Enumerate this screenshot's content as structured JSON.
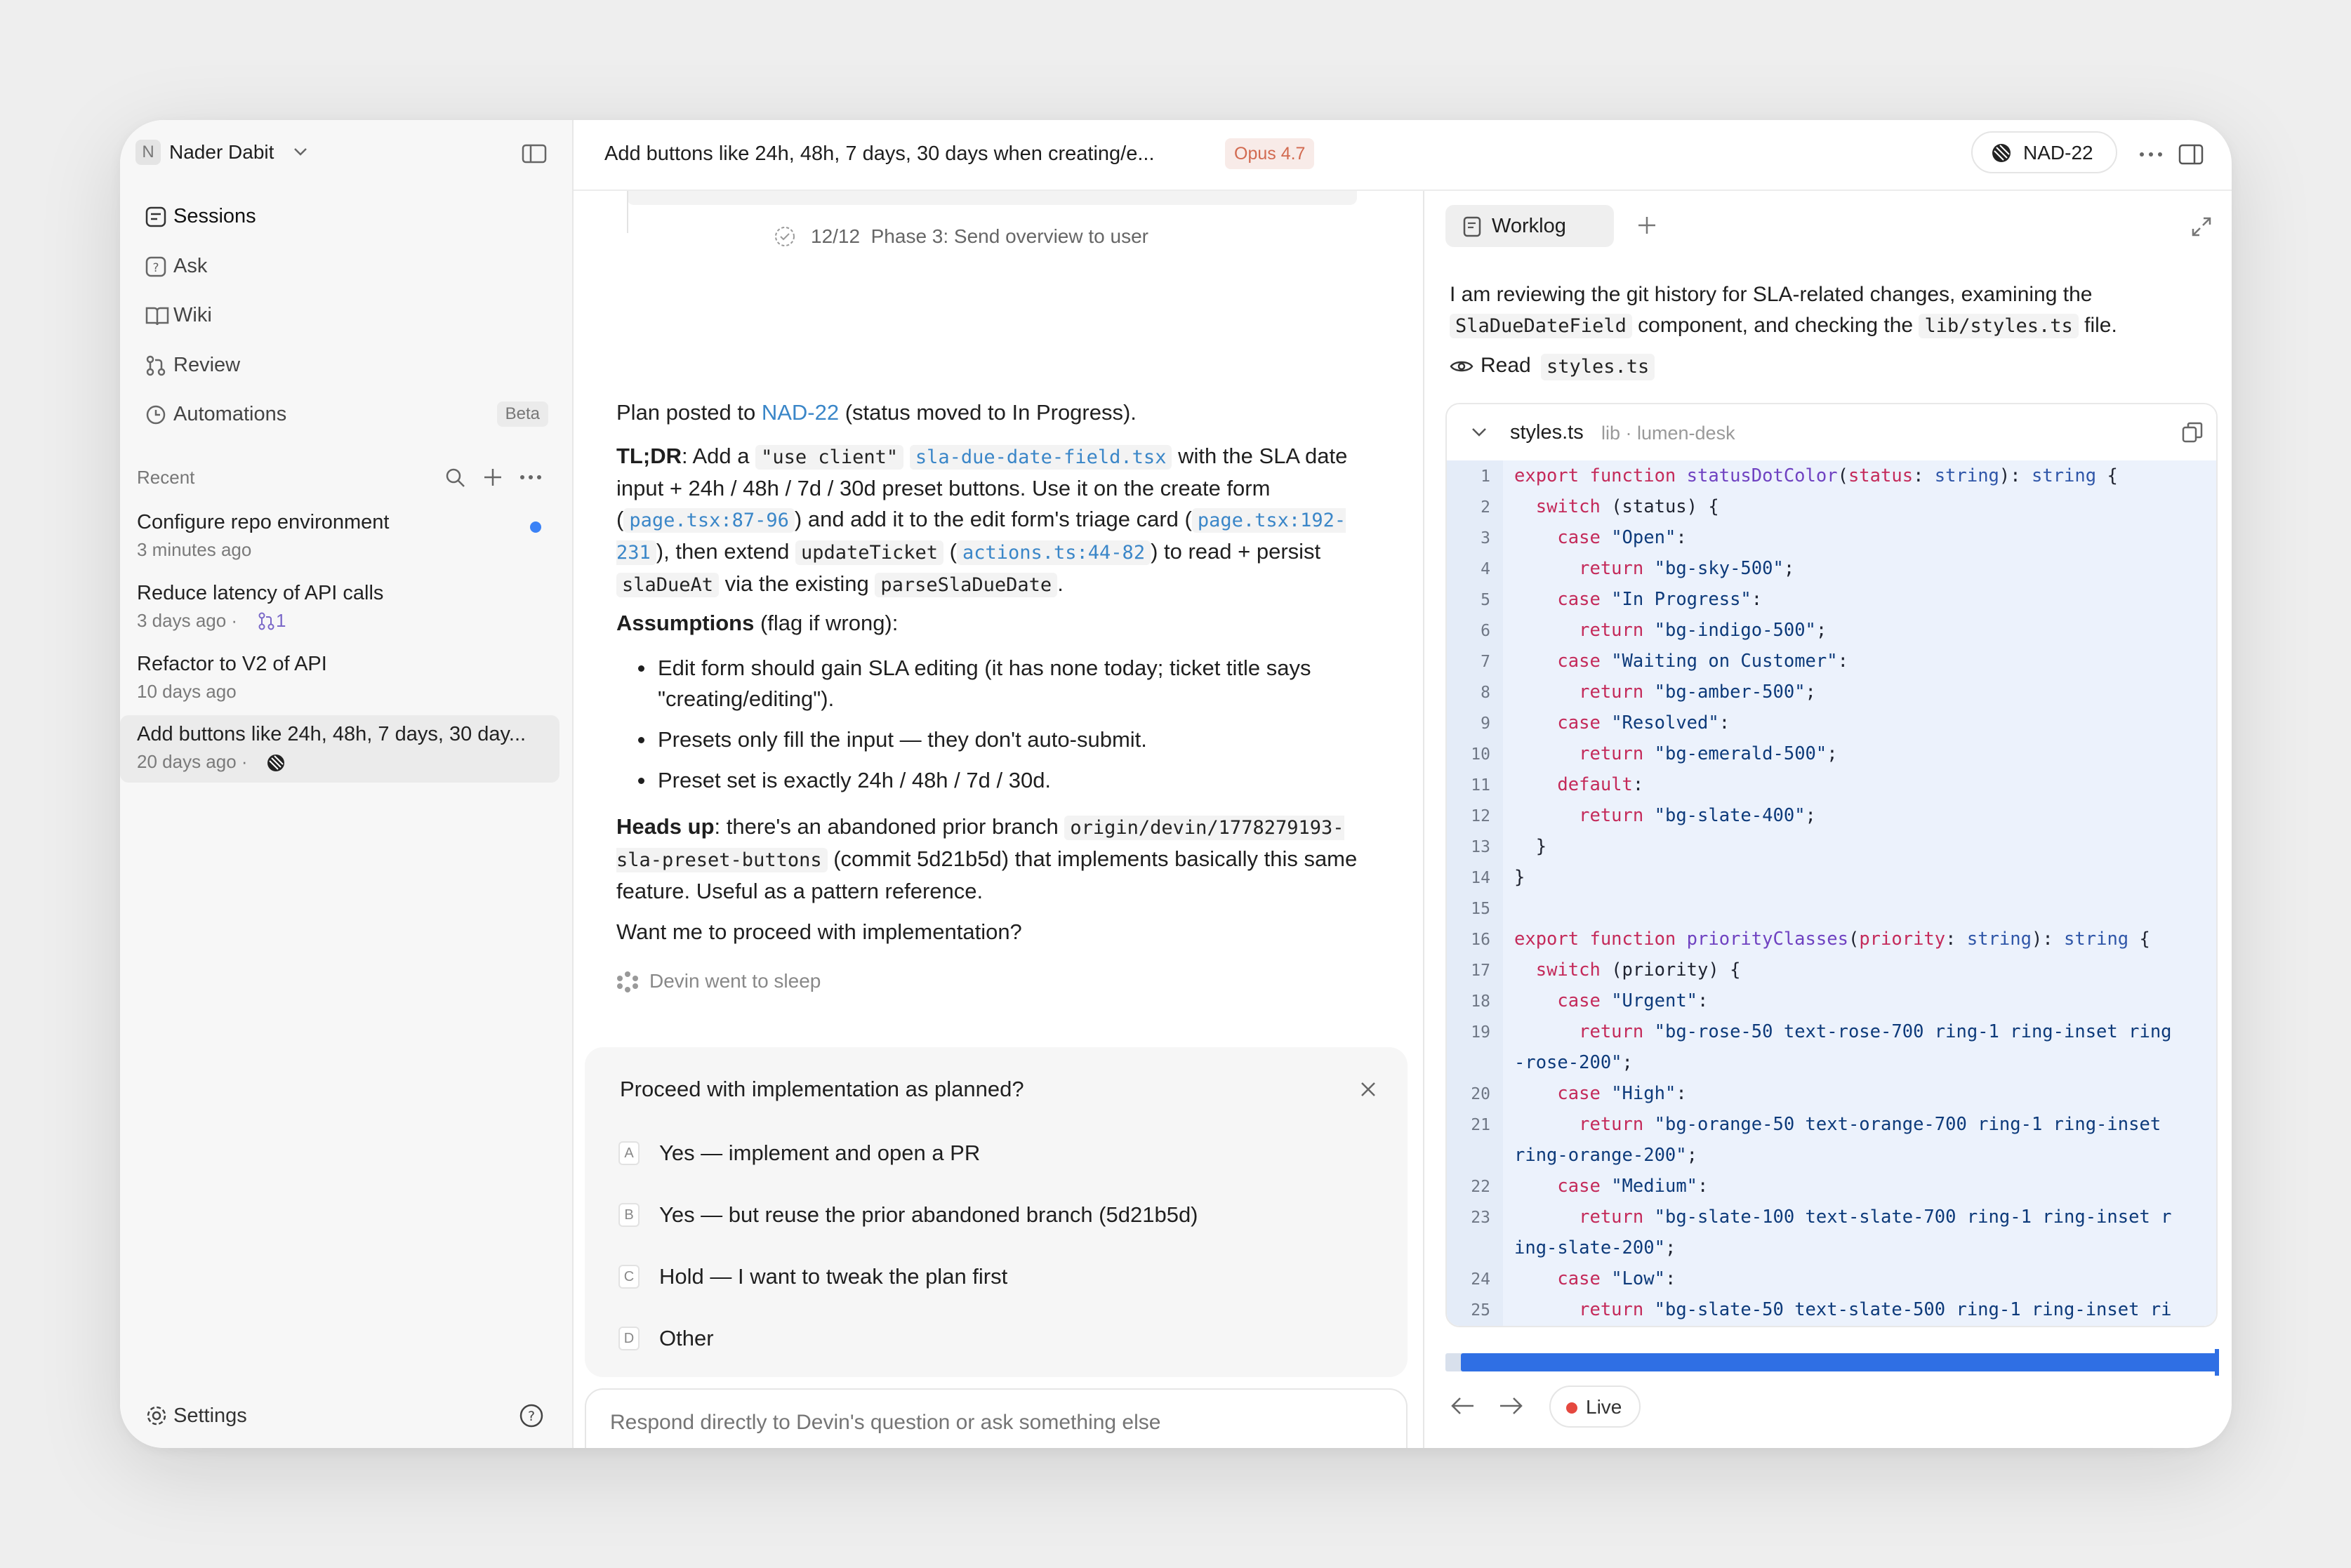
{
  "workspace": {
    "avatar_letter": "N",
    "name": "Nader Dabit"
  },
  "nav": [
    {
      "label": "Sessions",
      "icon": "sessions-icon"
    },
    {
      "label": "Ask",
      "icon": "ask-icon"
    },
    {
      "label": "Wiki",
      "icon": "book-icon"
    },
    {
      "label": "Review",
      "icon": "pull-request-icon"
    },
    {
      "label": "Automations",
      "icon": "clock-icon",
      "badge": "Beta"
    }
  ],
  "recent": {
    "heading": "Recent",
    "items": [
      {
        "title": "Configure repo environment",
        "meta": "3 minutes ago",
        "unread": true
      },
      {
        "title": "Reduce latency of API calls",
        "meta": "3 days ago ·",
        "pr_count": "1"
      },
      {
        "title": "Refactor to V2 of API",
        "meta": "10 days ago"
      },
      {
        "title": "Add buttons like 24h, 48h, 7 days, 30 day...",
        "meta": "20 days ago ·",
        "selected": true
      }
    ]
  },
  "settings_label": "Settings",
  "header": {
    "title": "Add buttons like 24h, 48h, 7 days, 30 days when creating/e...",
    "model_badge": "Opus 4.7",
    "ticket": "NAD-22"
  },
  "chat": {
    "phase_line": "12/12  Phase 3: Send overview to user",
    "plan_prefix": "Plan posted to ",
    "plan_link": "NAD-22",
    "plan_suffix": " (status moved to In Progress).",
    "tldr": {
      "label": "TL;DR",
      "t1": ": Add a ",
      "c1": "\"use client\"",
      "l1": "sla-due-date-field.tsx",
      "t2": " with the SLA date input + 24h / 48h / 7d / 30d preset buttons. Use it on the create form (",
      "l2": "page.tsx:87-96",
      "t3": ") and add it to the edit form's triage card (",
      "l3": "page.tsx:192-231",
      "t4": "), then extend ",
      "c2": "updateTicket",
      "t5": " (",
      "l4": "actions.ts:44-82",
      "t6": ") to read + persist ",
      "c3": "slaDueAt",
      "t7": " via the existing ",
      "c4": "parseSlaDueDate",
      "t8": "."
    },
    "assumptions_label": "Assumptions",
    "assumptions_suffix": " (flag if wrong):",
    "bullets": [
      "Edit form should gain SLA editing (it has none today; ticket title says \"creating/editing\").",
      "Presets only fill the input — they don't auto-submit.",
      "Preset set is exactly 24h / 48h / 7d / 30d."
    ],
    "headsup_label": "Heads up",
    "headsup_t1": ": there's an abandoned prior branch ",
    "headsup_code": "origin/devin/1778279193-sla-preset-buttons",
    "headsup_t2": " (commit 5d21b5d) that implements basically this same feature. Useful as a pattern reference.",
    "question": "Want me to proceed with implementation?",
    "sleep_status": "Devin went to sleep"
  },
  "prompt_card": {
    "title": "Proceed with implementation as planned?",
    "options": [
      {
        "key": "A",
        "label": "Yes — implement and open a PR"
      },
      {
        "key": "B",
        "label": "Yes — but reuse the prior abandoned branch (5d21b5d)"
      },
      {
        "key": "C",
        "label": "Hold — I want to tweak the plan first"
      },
      {
        "key": "D",
        "label": "Other"
      }
    ]
  },
  "input": {
    "placeholder": "Respond directly to Devin's question or ask something else"
  },
  "worklog": {
    "tab_label": "Worklog",
    "summary_t1": "I am reviewing the git history for SLA-related changes, examining the ",
    "summary_c1": "SlaDueDateField",
    "summary_t2": " component, and checking the ",
    "summary_c2": "lib/styles.ts",
    "summary_t3": " file.",
    "read_label": "Read",
    "read_file": "styles.ts",
    "file": {
      "name": "styles.ts",
      "path": "lib · lumen-desk"
    },
    "live_label": "Live",
    "progress": 0.98
  },
  "colors": {
    "accent": "#2f6fe4",
    "link": "#3a86c8",
    "live": "#e5483f",
    "unread": "#3b82f6",
    "badge": "#d26a50"
  }
}
